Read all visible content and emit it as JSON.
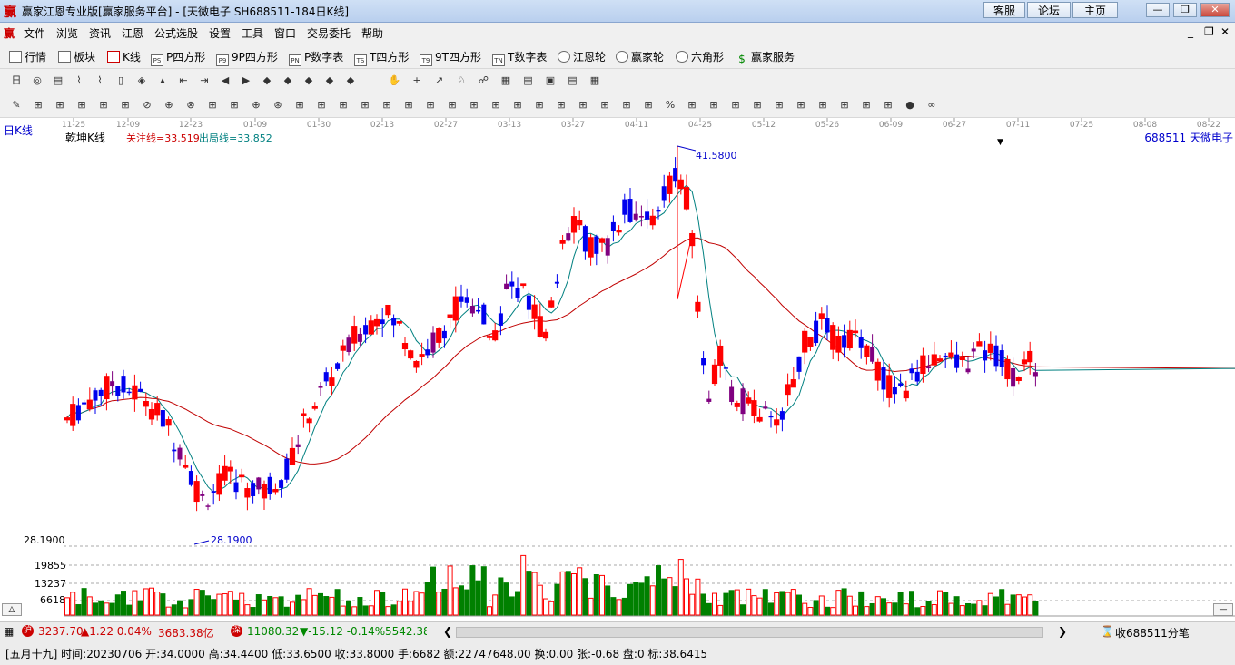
{
  "window": {
    "title": "赢家江恩专业版[赢家服务平台] - [天微电子  SH688511-184日K线]",
    "links": [
      "客服",
      "论坛",
      "主页"
    ]
  },
  "menu": [
    "文件",
    "浏览",
    "资讯",
    "江恩",
    "公式选股",
    "设置",
    "工具",
    "窗口",
    "交易委托",
    "帮助"
  ],
  "toolbar1": [
    {
      "label": "行情",
      "icon": "table-icon"
    },
    {
      "label": "板块",
      "icon": "blocks-icon"
    },
    {
      "label": "K线",
      "icon": "candle-icon"
    },
    {
      "label": "P四方形",
      "icon": "ps-icon",
      "tag": "PS"
    },
    {
      "label": "9P四方形",
      "icon": "p9-icon",
      "tag": "P9"
    },
    {
      "label": "P数字表",
      "icon": "pn-icon",
      "tag": "PN"
    },
    {
      "label": "T四方形",
      "icon": "ts-icon",
      "tag": "TS"
    },
    {
      "label": "9T四方形",
      "icon": "t9-icon",
      "tag": "T9"
    },
    {
      "label": "T数字表",
      "icon": "tn-icon",
      "tag": "TN"
    },
    {
      "label": "江恩轮",
      "icon": "gann-wheel-icon"
    },
    {
      "label": "赢家轮",
      "icon": "winner-wheel-icon"
    },
    {
      "label": "六角形",
      "icon": "hexagon-icon"
    },
    {
      "label": "赢家服务",
      "icon": "dollar-icon"
    }
  ],
  "chart": {
    "period_label": "日K线",
    "indicator_name": "乾坤K线",
    "attention_line": "关注线=33.519",
    "exit_line": "出局线=33.852",
    "stock_label": "688511  天微电子",
    "high_label": "41.5800",
    "low_label": "28.1900",
    "date_ticks": [
      "11-25",
      "12-09",
      "12-23",
      "01-09",
      "01-30",
      "02-13",
      "02-27",
      "03-13",
      "03-27",
      "04-11",
      "04-25",
      "05-12",
      "05-26",
      "06-09",
      "06-27",
      "07-11",
      "07-25",
      "08-08",
      "08-22"
    ],
    "price_axis_label": "28.1900",
    "volume_axis": [
      "19855",
      "13237",
      "6618"
    ],
    "colors": {
      "up": "#ff0000",
      "down": "#0000ee",
      "mid": "#800080",
      "ma_short": "#008080",
      "ma_long": "#c00000"
    }
  },
  "chart_data": {
    "type": "candlestick",
    "x_axis_ticks": [
      "11-25",
      "12-09",
      "12-23",
      "01-09",
      "01-30",
      "02-13",
      "02-27",
      "03-13",
      "03-27",
      "04-11",
      "04-25",
      "05-12",
      "05-26",
      "06-09",
      "06-27",
      "07-11",
      "07-25",
      "08-08",
      "08-22"
    ],
    "annotations": {
      "high": 41.58,
      "low": 28.19
    },
    "indicators": {
      "关注线": 33.519,
      "出局线": 33.852
    },
    "volume_levels": [
      19855,
      13237,
      6618
    ]
  },
  "status1": {
    "sh_index": "3237.70",
    "sh_change": "▲1.22 0.04%",
    "sh_amount": "3683.38亿",
    "sz_index": "11080.32",
    "sz_change": "▼-15.12 -0.14%",
    "sz_amount": "5542.38",
    "ticks_label": "收688511分笔"
  },
  "status2": {
    "text": "[五月十九] 时间:20230706 开:34.0000 高:34.4400 低:33.6500 收:33.8000 手:6682 额:22747648.00 换:0.00 张:-0.68 盘:0 标:38.6415"
  }
}
